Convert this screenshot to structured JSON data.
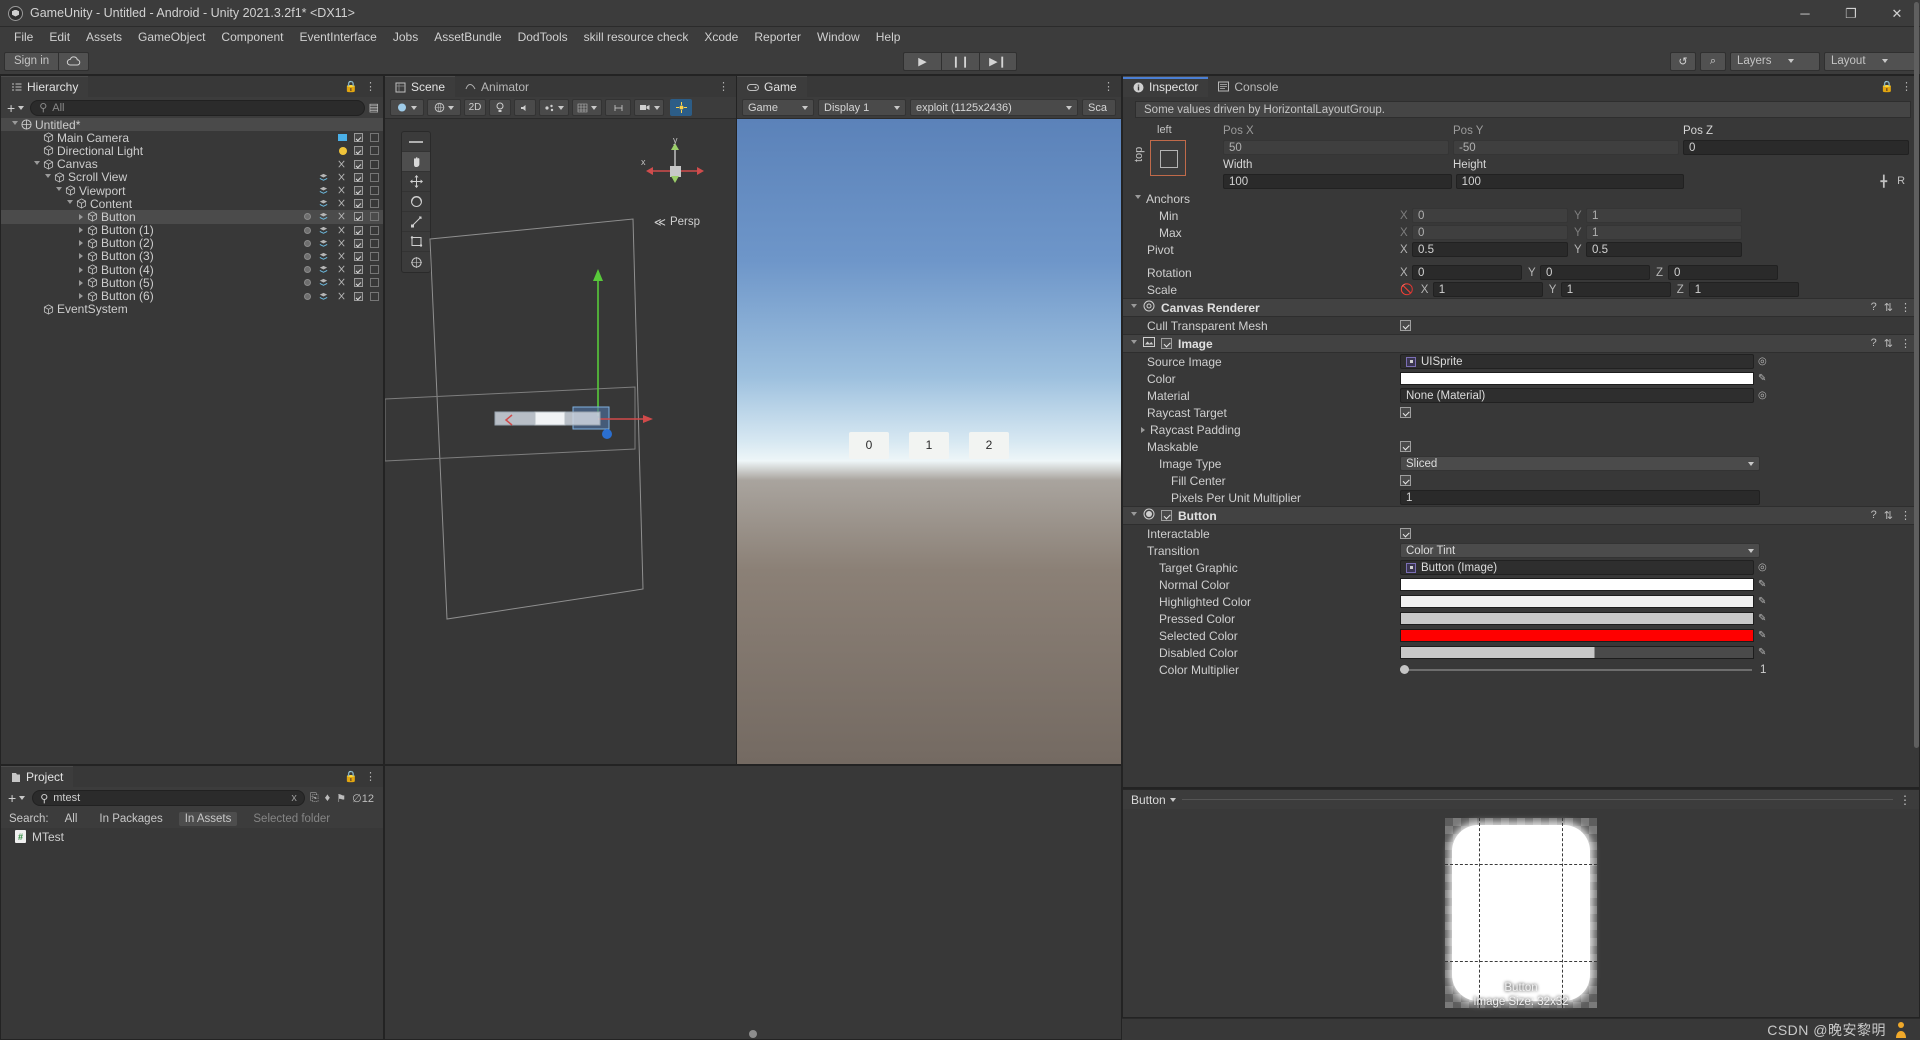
{
  "window": {
    "title": "GameUnity - Untitled - Android - Unity 2021.3.2f1* <DX11>",
    "minimize": "─",
    "maximize": "❐",
    "close": "✕"
  },
  "menu": [
    "File",
    "Edit",
    "Assets",
    "GameObject",
    "Component",
    "EventInterface",
    "Jobs",
    "AssetBundle",
    "DodTools",
    "skill resource check",
    "Xcode",
    "Reporter",
    "Window",
    "Help"
  ],
  "toolbar": {
    "signin": "Sign in",
    "cloud_icon": "cloud-icon",
    "play": "▶",
    "pause": "❙❙",
    "step": "▶❙",
    "history_icon": "↺",
    "search_icon": "⌕",
    "layers": "Layers",
    "layout": "Layout"
  },
  "hierarchy": {
    "tab": "Hierarchy",
    "add_label": "+",
    "search_placeholder": "All",
    "lock_icon": "lock-icon",
    "menu_icon": "⋮",
    "rows": [
      {
        "label": "Untitled*",
        "depth": 0,
        "type": "scene",
        "expanded": true,
        "selected": false
      },
      {
        "label": "Main Camera",
        "depth": 2,
        "type": "go",
        "expanded": null,
        "selected": false
      },
      {
        "label": "Directional Light",
        "depth": 2,
        "type": "go",
        "expanded": null,
        "selected": false
      },
      {
        "label": "Canvas",
        "depth": 2,
        "type": "go",
        "expanded": true,
        "selected": false
      },
      {
        "label": "Scroll View",
        "depth": 3,
        "type": "go",
        "expanded": true,
        "selected": false
      },
      {
        "label": "Viewport",
        "depth": 4,
        "type": "go",
        "expanded": true,
        "selected": false
      },
      {
        "label": "Content",
        "depth": 5,
        "type": "go",
        "expanded": true,
        "selected": false
      },
      {
        "label": "Button",
        "depth": 6,
        "type": "go",
        "expanded": false,
        "selected": true
      },
      {
        "label": "Button (1)",
        "depth": 6,
        "type": "go",
        "expanded": false,
        "selected": false
      },
      {
        "label": "Button (2)",
        "depth": 6,
        "type": "go",
        "expanded": false,
        "selected": false
      },
      {
        "label": "Button (3)",
        "depth": 6,
        "type": "go",
        "expanded": false,
        "selected": false
      },
      {
        "label": "Button (4)",
        "depth": 6,
        "type": "go",
        "expanded": false,
        "selected": false
      },
      {
        "label": "Button (5)",
        "depth": 6,
        "type": "go",
        "expanded": false,
        "selected": false
      },
      {
        "label": "Button (6)",
        "depth": 6,
        "type": "go",
        "expanded": false,
        "selected": false
      },
      {
        "label": "EventSystem",
        "depth": 2,
        "type": "go",
        "expanded": null,
        "selected": false
      }
    ]
  },
  "scene": {
    "tab": "Scene",
    "animator_tab": "Animator",
    "menu_icon": "⋮",
    "shading_mode": "shaded-dropdown",
    "twod_label": "2D",
    "light_icon": "light-bulb-icon",
    "audio_icon": "audio-icon",
    "fx_icon": "fx-icon",
    "gizmos_icon": "gizmos-icon",
    "view_label": "Persp",
    "axis_y": "y",
    "axis_x": "x",
    "tools": [
      "hand-tool",
      "move-tool",
      "rotate-tool",
      "scale-tool",
      "rect-tool",
      "transform-tool"
    ]
  },
  "game": {
    "tab": "Game",
    "display_label": "Game",
    "display": "Display 1",
    "resolution": "exploit (1125x2436)",
    "scale_label": "Sca",
    "menu_icon": "⋮",
    "buttons": [
      "0",
      "1",
      "2"
    ]
  },
  "project": {
    "tab": "Project",
    "add_label": "+",
    "search_value": "mtest",
    "search_clear": "x",
    "filter_label": "Search:",
    "filters": [
      {
        "label": "All",
        "active": false
      },
      {
        "label": "In Packages",
        "active": false
      },
      {
        "label": "In Assets",
        "active": true
      },
      {
        "label": "Selected folder",
        "active": false,
        "dim": true
      }
    ],
    "result_count": "12",
    "items": [
      {
        "label": "MTest",
        "icon": "csharp-script-icon"
      }
    ],
    "lock_icon": "lock-icon",
    "menu_icon": "⋮"
  },
  "inspector": {
    "tab": "Inspector",
    "console_tab": "Console",
    "lock_icon": "lock-icon",
    "menu_icon": "⋮",
    "help_text": "Some values driven by HorizontalLayoutGroup.",
    "rect_transform": {
      "anchor_left": "left",
      "anchor_top": "top",
      "headers": [
        "Pos X",
        "Pos Y",
        "Pos Z"
      ],
      "pos": [
        "50",
        "-50",
        "0"
      ],
      "size_headers": [
        "Width",
        "Height"
      ],
      "size": [
        "100",
        "100"
      ],
      "blueprint_icon": "blueprint-icon",
      "raw_icon": "R",
      "anchors_label": "Anchors",
      "min_label": "Min",
      "min": {
        "x": "0",
        "y": "1"
      },
      "max_label": "Max",
      "max": {
        "x": "0",
        "y": "1"
      },
      "pivot_label": "Pivot",
      "pivot": {
        "x": "0.5",
        "y": "0.5"
      },
      "rotation_label": "Rotation",
      "rotation": {
        "x": "0",
        "y": "0",
        "z": "0"
      },
      "scale_label": "Scale",
      "scale": {
        "x": "1",
        "y": "1",
        "z": "1"
      },
      "scale_link_icon": "link-off-icon"
    },
    "canvas_renderer": {
      "title": "Canvas Renderer",
      "icon": "canvas-renderer-icon",
      "cull_label": "Cull Transparent Mesh",
      "cull_checked": true,
      "help_icon": "?",
      "preset_icon": "⇅",
      "menu_icon": "⋮"
    },
    "image": {
      "title": "Image",
      "icon": "image-icon",
      "enabled": true,
      "source_image_label": "Source Image",
      "source_image_value": "UISprite",
      "color_label": "Color",
      "color_value": "#FFFFFF",
      "material_label": "Material",
      "material_value": "None (Material)",
      "raycast_target_label": "Raycast Target",
      "raycast_target_checked": true,
      "raycast_padding_label": "Raycast Padding",
      "maskable_label": "Maskable",
      "maskable_checked": true,
      "image_type_label": "Image Type",
      "image_type_value": "Sliced",
      "fill_center_label": "Fill Center",
      "fill_center_checked": true,
      "ppu_label": "Pixels Per Unit Multiplier",
      "ppu_value": "1",
      "help_icon": "?",
      "preset_icon": "⇅",
      "menu_icon": "⋮"
    },
    "button": {
      "title": "Button",
      "icon": "button-icon",
      "enabled": true,
      "interactable_label": "Interactable",
      "interactable_checked": true,
      "transition_label": "Transition",
      "transition_value": "Color Tint",
      "target_graphic_label": "Target Graphic",
      "target_graphic_value": "Button (Image)",
      "colors": [
        {
          "label": "Normal Color",
          "hex": "#FFFFFF"
        },
        {
          "label": "Highlighted Color",
          "hex": "#F0F0F0"
        },
        {
          "label": "Pressed Color",
          "hex": "#C8C8C8"
        },
        {
          "label": "Selected Color",
          "hex": "#FF0000"
        },
        {
          "label": "Disabled Color",
          "hex": "#C8C8C8",
          "partial": 55
        }
      ],
      "color_multiplier_label": "Color Multiplier",
      "color_multiplier_value": "1",
      "help_icon": "?",
      "preset_icon": "⇅",
      "menu_icon": "⋮"
    }
  },
  "preview": {
    "title": "Button",
    "menu_icon": "⋮",
    "sprite_caption": "Button",
    "image_size": "Image Size: 32x32"
  },
  "watermark": "CSDN @晚安黎明",
  "colors": {
    "accent_blue": "#4b7fd4",
    "selected_red": "#ff0000",
    "panel_bg": "#383838",
    "header_bg": "#424242"
  }
}
